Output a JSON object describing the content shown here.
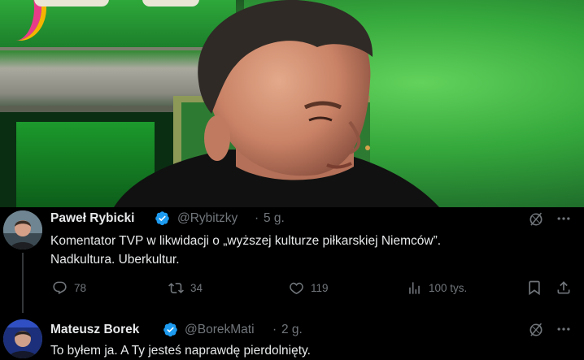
{
  "media": {
    "description_icon": "video-still"
  },
  "tweets": [
    {
      "author_name": "Paweł Rybicki",
      "handle": "@Rybitzky",
      "separator": "·",
      "time": "5 g.",
      "text_line1": "Komentator TVP w likwidacji o „wyższej kulturze piłkarskiej Niemców”.",
      "text_line2": "Nadkultura. Uberkultur.",
      "replies": "78",
      "retweets": "34",
      "likes": "119",
      "views": "100 tys."
    },
    {
      "author_name": "Mateusz Borek",
      "handle": "@BorekMati",
      "separator": "·",
      "time": "2 g.",
      "text_line1": "To byłem ja. A Ty jesteś naprawdę pierdolnięty."
    }
  ],
  "colors": {
    "background": "#000000",
    "text": "#e7e9ea",
    "muted": "#71767b",
    "verified": "#1d9bf0",
    "thread_line": "#333639"
  },
  "icons": [
    "grok-icon",
    "more-icon",
    "reply-icon",
    "retweet-icon",
    "like-icon",
    "views-icon",
    "bookmark-icon",
    "share-icon",
    "verified-badge-icon"
  ]
}
